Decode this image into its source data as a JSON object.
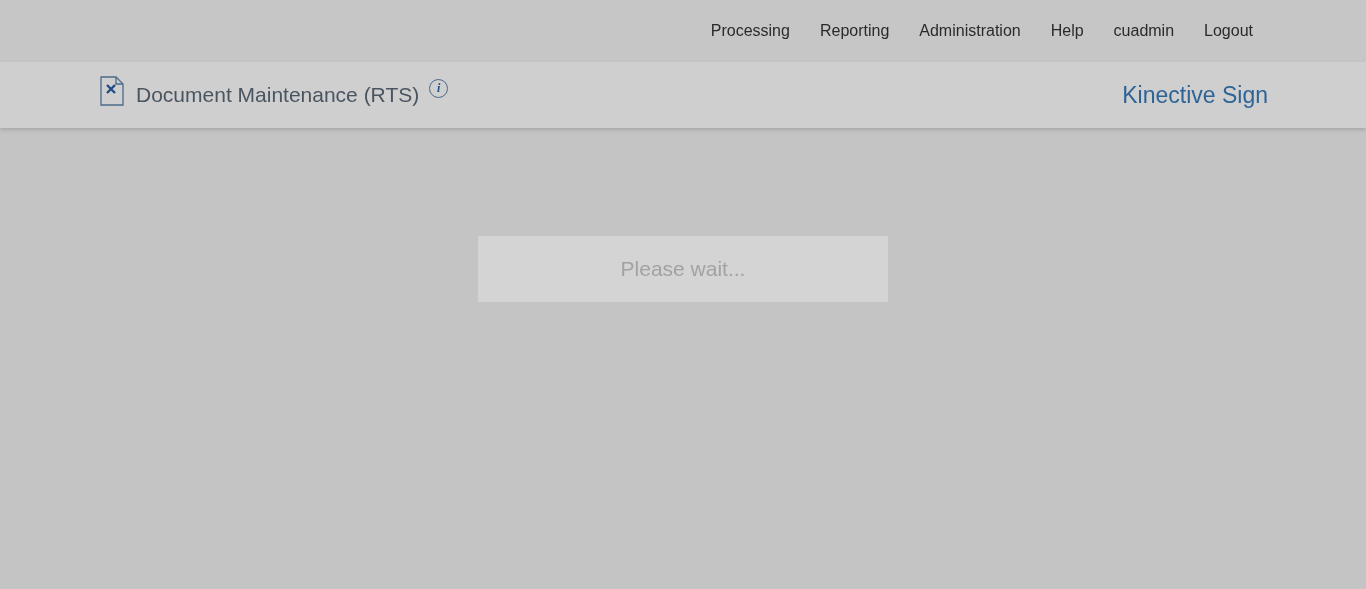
{
  "top_nav": {
    "items": [
      {
        "label": "Processing"
      },
      {
        "label": "Reporting"
      },
      {
        "label": "Administration"
      },
      {
        "label": "Help"
      },
      {
        "label": "cuadmin"
      },
      {
        "label": "Logout"
      }
    ]
  },
  "header": {
    "title": "Document Maintenance (RTS)",
    "info_icon": "i",
    "brand": "Kinective Sign"
  },
  "loading": {
    "message": "Please wait..."
  }
}
